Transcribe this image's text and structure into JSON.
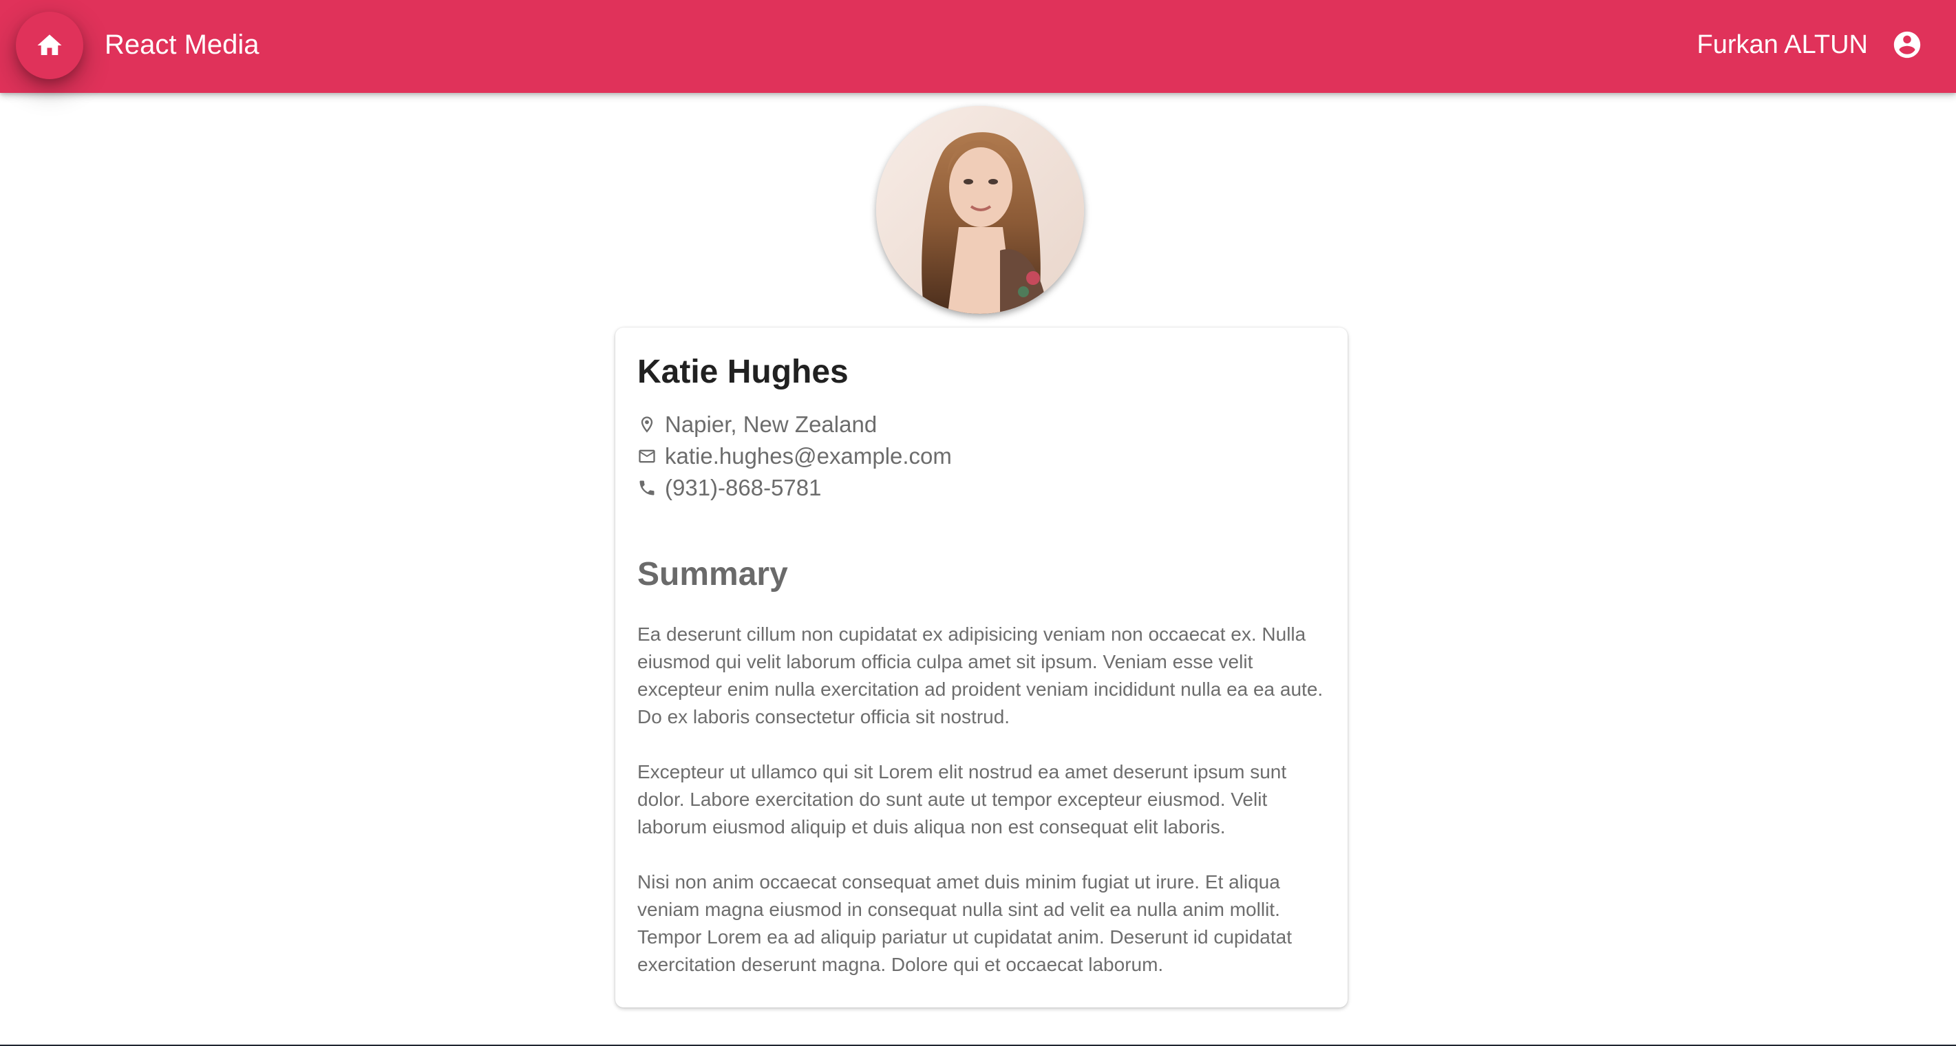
{
  "appbar": {
    "title": "React Media",
    "user_name": "Furkan ALTUN",
    "home_icon": "home-icon",
    "user_icon": "account-circle-icon",
    "accent_color": "#e0325a"
  },
  "profile": {
    "name": "Katie Hughes",
    "location": "Napier, New Zealand",
    "email": "katie.hughes@example.com",
    "phone": "(931)-868-5781",
    "summary_title": "Summary",
    "paragraphs": [
      "Ea deserunt cillum non cupidatat ex adipisicing veniam non occaecat ex. Nulla eiusmod qui velit laborum officia culpa amet sit ipsum. Veniam esse velit excepteur enim nulla exercitation ad proident veniam incididunt nulla ea ea aute. Do ex laboris consectetur officia sit nostrud.",
      "Excepteur ut ullamco qui sit Lorem elit nostrud ea amet deserunt ipsum sunt dolor. Labore exercitation do sunt aute ut tempor excepteur eiusmod. Velit laborum eiusmod aliquip et duis aliqua non est consequat elit laboris.",
      "Nisi non anim occaecat consequat amet duis minim fugiat ut irure. Et aliqua veniam magna eiusmod in consequat nulla sint ad velit ea nulla anim mollit. Tempor Lorem ea ad aliquip pariatur ut cupidatat anim. Deserunt id cupidatat exercitation deserunt magna. Dolore qui et occaecat laborum."
    ]
  }
}
